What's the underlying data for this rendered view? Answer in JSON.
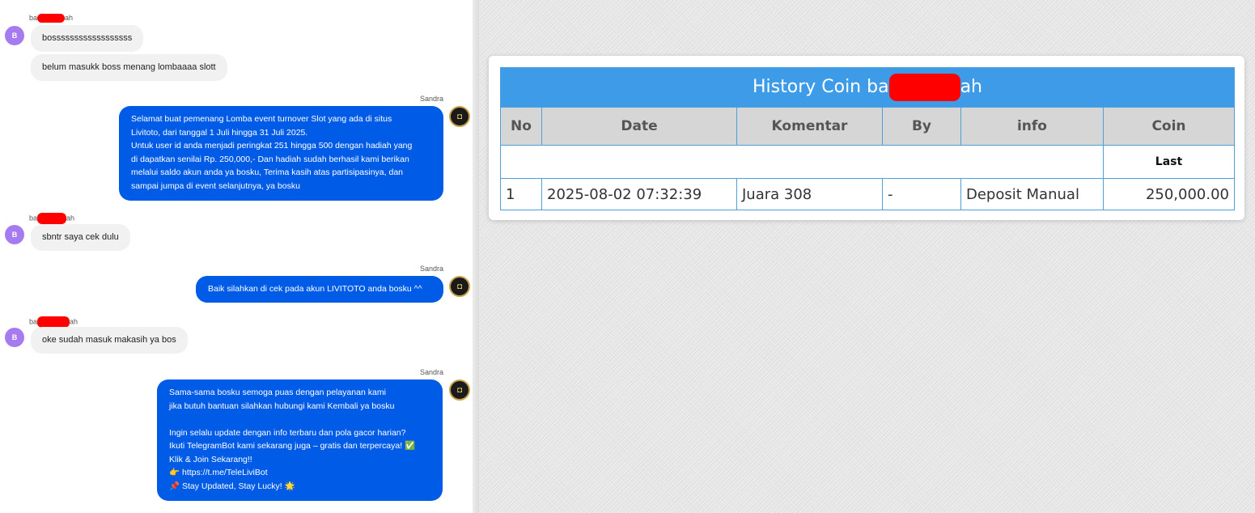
{
  "chat": {
    "messages": [
      {
        "sender_prefix": "ba",
        "sender_suffix": "ah",
        "avatar": "B",
        "bubbles": [
          "bossssssssssssssssss",
          "belum masukk boss menang lombaaaa slott"
        ]
      },
      {
        "sender": "Sandra",
        "text": "Selamat buat pemenang Lomba event turnover Slot yang ada di situs\nLivitoto, dari tanggal 1 Juli hingga 31 Juli 2025.\nUntuk user id anda menjadi peringkat 251 hingga 500 dengan hadiah yang\ndi dapatkan senilai Rp. 250,000,- Dan hadiah sudah berhasil kami berikan\nmelalui saldo akun anda ya bosku, Terima kasih atas partisipasinya, dan\nsampai jumpa di event selanjutnya, ya bosku"
      },
      {
        "sender_prefix": "ba",
        "sender_suffix": "ah",
        "avatar": "B",
        "bubbles": [
          "sbntr saya cek dulu"
        ]
      },
      {
        "sender": "Sandra",
        "text": "Baik silahkan di cek pada akun LIVITOTO anda bosku ^^"
      },
      {
        "sender_prefix": "ba",
        "sender_suffix": "ah",
        "avatar": "B",
        "bubbles": [
          "oke sudah masuk makasih ya bos"
        ]
      },
      {
        "sender": "Sandra",
        "text": "Sama-sama bosku semoga puas dengan pelayanan kami\njika butuh bantuan silahkan hubungi kami Kembali ya bosku\n\nIngin selalu update dengan info terbaru dan pola gacor harian?\nIkuti TelegramBot kami sekarang juga – gratis dan terpercaya! ✅\nKlik & Join Sekarang!!\n👉 https://t.me/TeleLiviBot\n📌 Stay Updated, Stay Lucky! 🌟"
      }
    ]
  },
  "history": {
    "title_prefix": "History Coin ba",
    "title_suffix": "ah",
    "columns": [
      "No",
      "Date",
      "Komentar",
      "By",
      "info",
      "Coin"
    ],
    "last_label": "Last",
    "rows": [
      {
        "no": "1",
        "date": "2025-08-02 07:32:39",
        "komentar": "Juara 308",
        "by": "-",
        "info": "Deposit Manual",
        "coin": "250,000.00"
      }
    ]
  },
  "colors": {
    "outgoing_bubble": "#005ce6",
    "incoming_bubble": "#f1f1f1",
    "table_header": "#3e9be8",
    "coin_green": "#2c9a2c",
    "redaction": "#ff0000"
  }
}
